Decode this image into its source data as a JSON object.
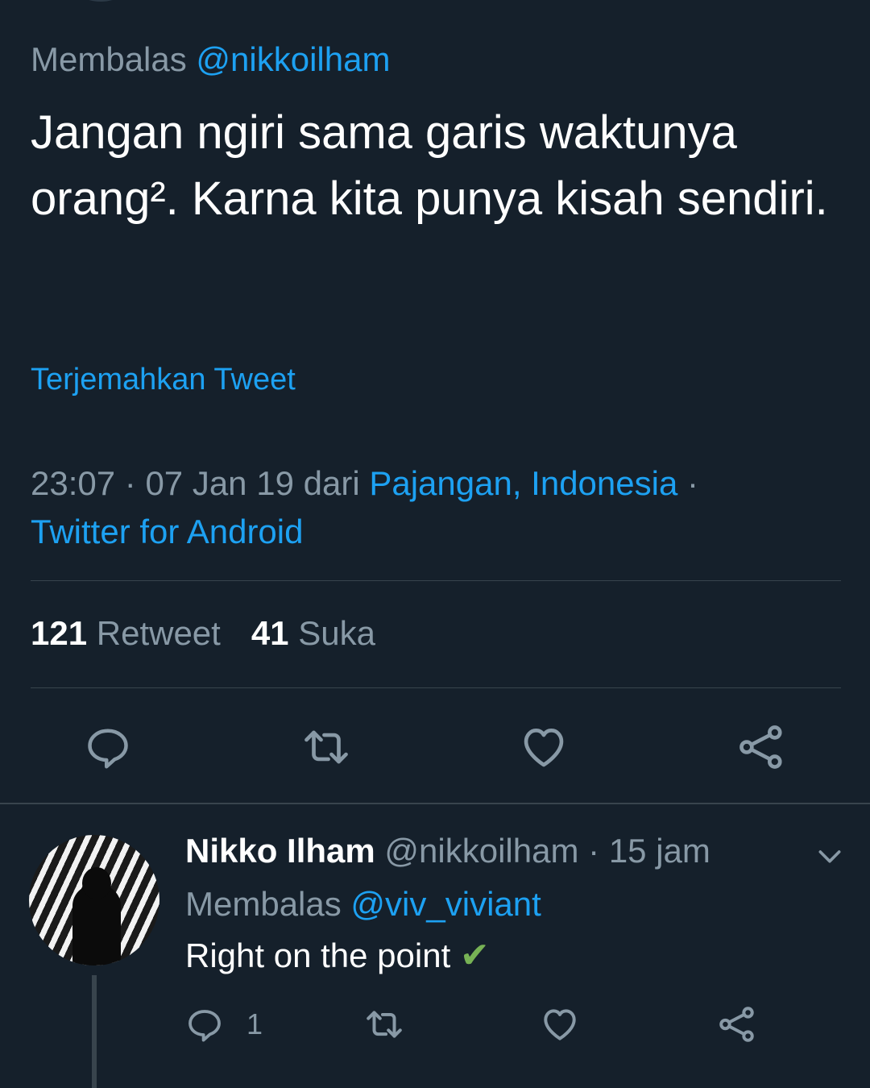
{
  "tweet": {
    "reply_prefix": "Membalas",
    "reply_handle": "@nikkoilham",
    "text": "Jangan ngiri sama garis waktunya orang². Karna kita punya kisah sendiri.",
    "translate_label": "Terjemahkan Tweet",
    "time": "23:07",
    "date": "07 Jan 19",
    "dari": "dari",
    "location": "Pajangan, Indonesia",
    "source": "Twitter for Android",
    "retweet_count": "121",
    "retweet_label": "Retweet",
    "like_count": "41",
    "like_label": "Suka"
  },
  "reply": {
    "name": "Nikko Ilham",
    "handle": "@nikkoilham",
    "time_ago": "15 jam",
    "reply_prefix": "Membalas",
    "reply_handle": "@viv_viviant",
    "text": "Right on the point",
    "emoji": "✔",
    "reply_count": "1"
  },
  "icons": {
    "action_bar": [
      "reply-icon",
      "retweet-icon",
      "like-icon",
      "share-icon"
    ],
    "menu": "chevron-down-icon"
  },
  "colors": {
    "background": "#15202b",
    "text": "#ffffff",
    "muted": "#8899a6",
    "link": "#1da1f2",
    "divider": "#38444d",
    "check": "#77b255"
  }
}
